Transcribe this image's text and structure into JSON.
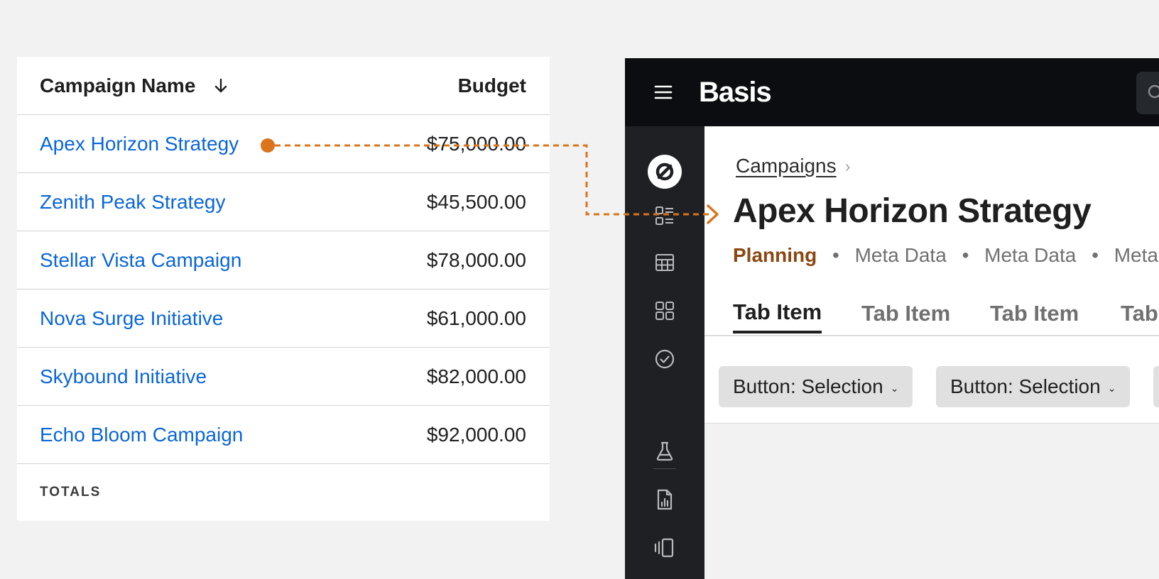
{
  "table": {
    "headers": {
      "name": "Campaign Name",
      "budget": "Budget"
    },
    "sort_icon": "arrow-down-icon",
    "rows": [
      {
        "name": "Apex Horizon Strategy",
        "budget": "$75,000.00"
      },
      {
        "name": "Zenith Peak Strategy",
        "budget": "$45,500.00"
      },
      {
        "name": "Stellar Vista Campaign",
        "budget": "$78,000.00"
      },
      {
        "name": "Nova Surge Initiative",
        "budget": "$61,000.00"
      },
      {
        "name": "Skybound Initiative",
        "budget": "$82,000.00"
      },
      {
        "name": "Echo Bloom Campaign",
        "budget": "$92,000.00"
      }
    ],
    "totals_label": "TOTALS"
  },
  "connector": {
    "color": "#d9751c"
  },
  "app": {
    "logo": "Basis",
    "breadcrumb": {
      "label": "Campaigns",
      "separator": "›"
    },
    "title": "Apex Horizon Strategy",
    "meta": {
      "status": "Planning",
      "items": [
        "Meta Data",
        "Meta Data",
        "Meta D"
      ]
    },
    "tabs": [
      "Tab Item",
      "Tab Item",
      "Tab Item",
      "Tab"
    ],
    "filters": [
      "Button: Selection",
      "Button: Selection"
    ],
    "nav_icons": [
      "brand-logo-icon",
      "list-detail-icon",
      "table-icon",
      "grid-icon",
      "check-circle-icon",
      "beaker-icon",
      "report-icon",
      "carousel-icon"
    ]
  },
  "colors": {
    "link": "#0a66d8",
    "topbar": "#0b0d10",
    "sidebar": "#1f2023",
    "status": "#8a4710",
    "accent": "#d9751c"
  }
}
